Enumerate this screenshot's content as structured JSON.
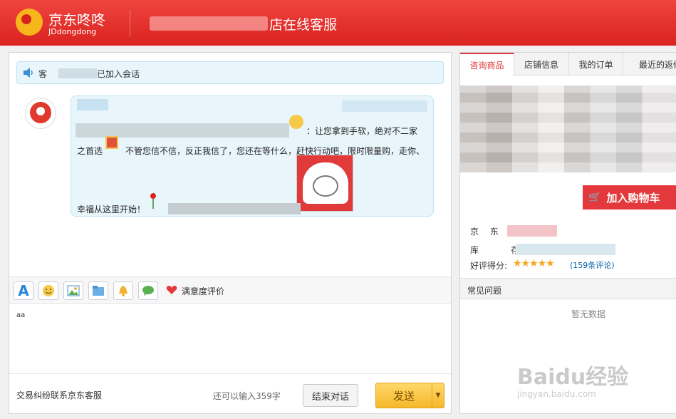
{
  "header": {
    "brand": "京东咚咚",
    "brand_sub": "JDdongdong",
    "shop_title": "店在线客服"
  },
  "chat": {
    "notice_prefix": "客",
    "notice_suffix": "已加入会话",
    "message": {
      "line1": "：让您拿到手软，绝对不二家",
      "line2": "之首选",
      "line3": "不管您信不信，反正我信了，您还在等什么，赶快行动吧，限时限量购，走你、",
      "line4": "幸福从这里开始！"
    },
    "toolbar": {
      "font_label": "A",
      "satisfaction_label": "满意度评价"
    },
    "input_value": "aa",
    "bottom": {
      "dispute_link": "交易纠纷联系京东客服",
      "remaining": "还可以输入359字",
      "end_button": "结束对话",
      "send_button": "发送"
    }
  },
  "right": {
    "tabs": [
      "咨询商品",
      "店铺信息",
      "我的订单",
      "最近的返修"
    ],
    "cart_button": "加入购物车",
    "price_label": "京 东 价",
    "stock_label": "库    存",
    "score_label": "好评得分:",
    "stars": "★★★★★",
    "reviews": "(159条评论)",
    "faq_title": "常见问题",
    "no_data": "暂无数据",
    "watermark": "Baidu经验",
    "watermark_sub": "jingyan.baidu.com"
  },
  "colors": {
    "brand_red": "#e4393c",
    "send_orange": "#f5b82a",
    "bubble_blue": "#e8f6fc"
  }
}
